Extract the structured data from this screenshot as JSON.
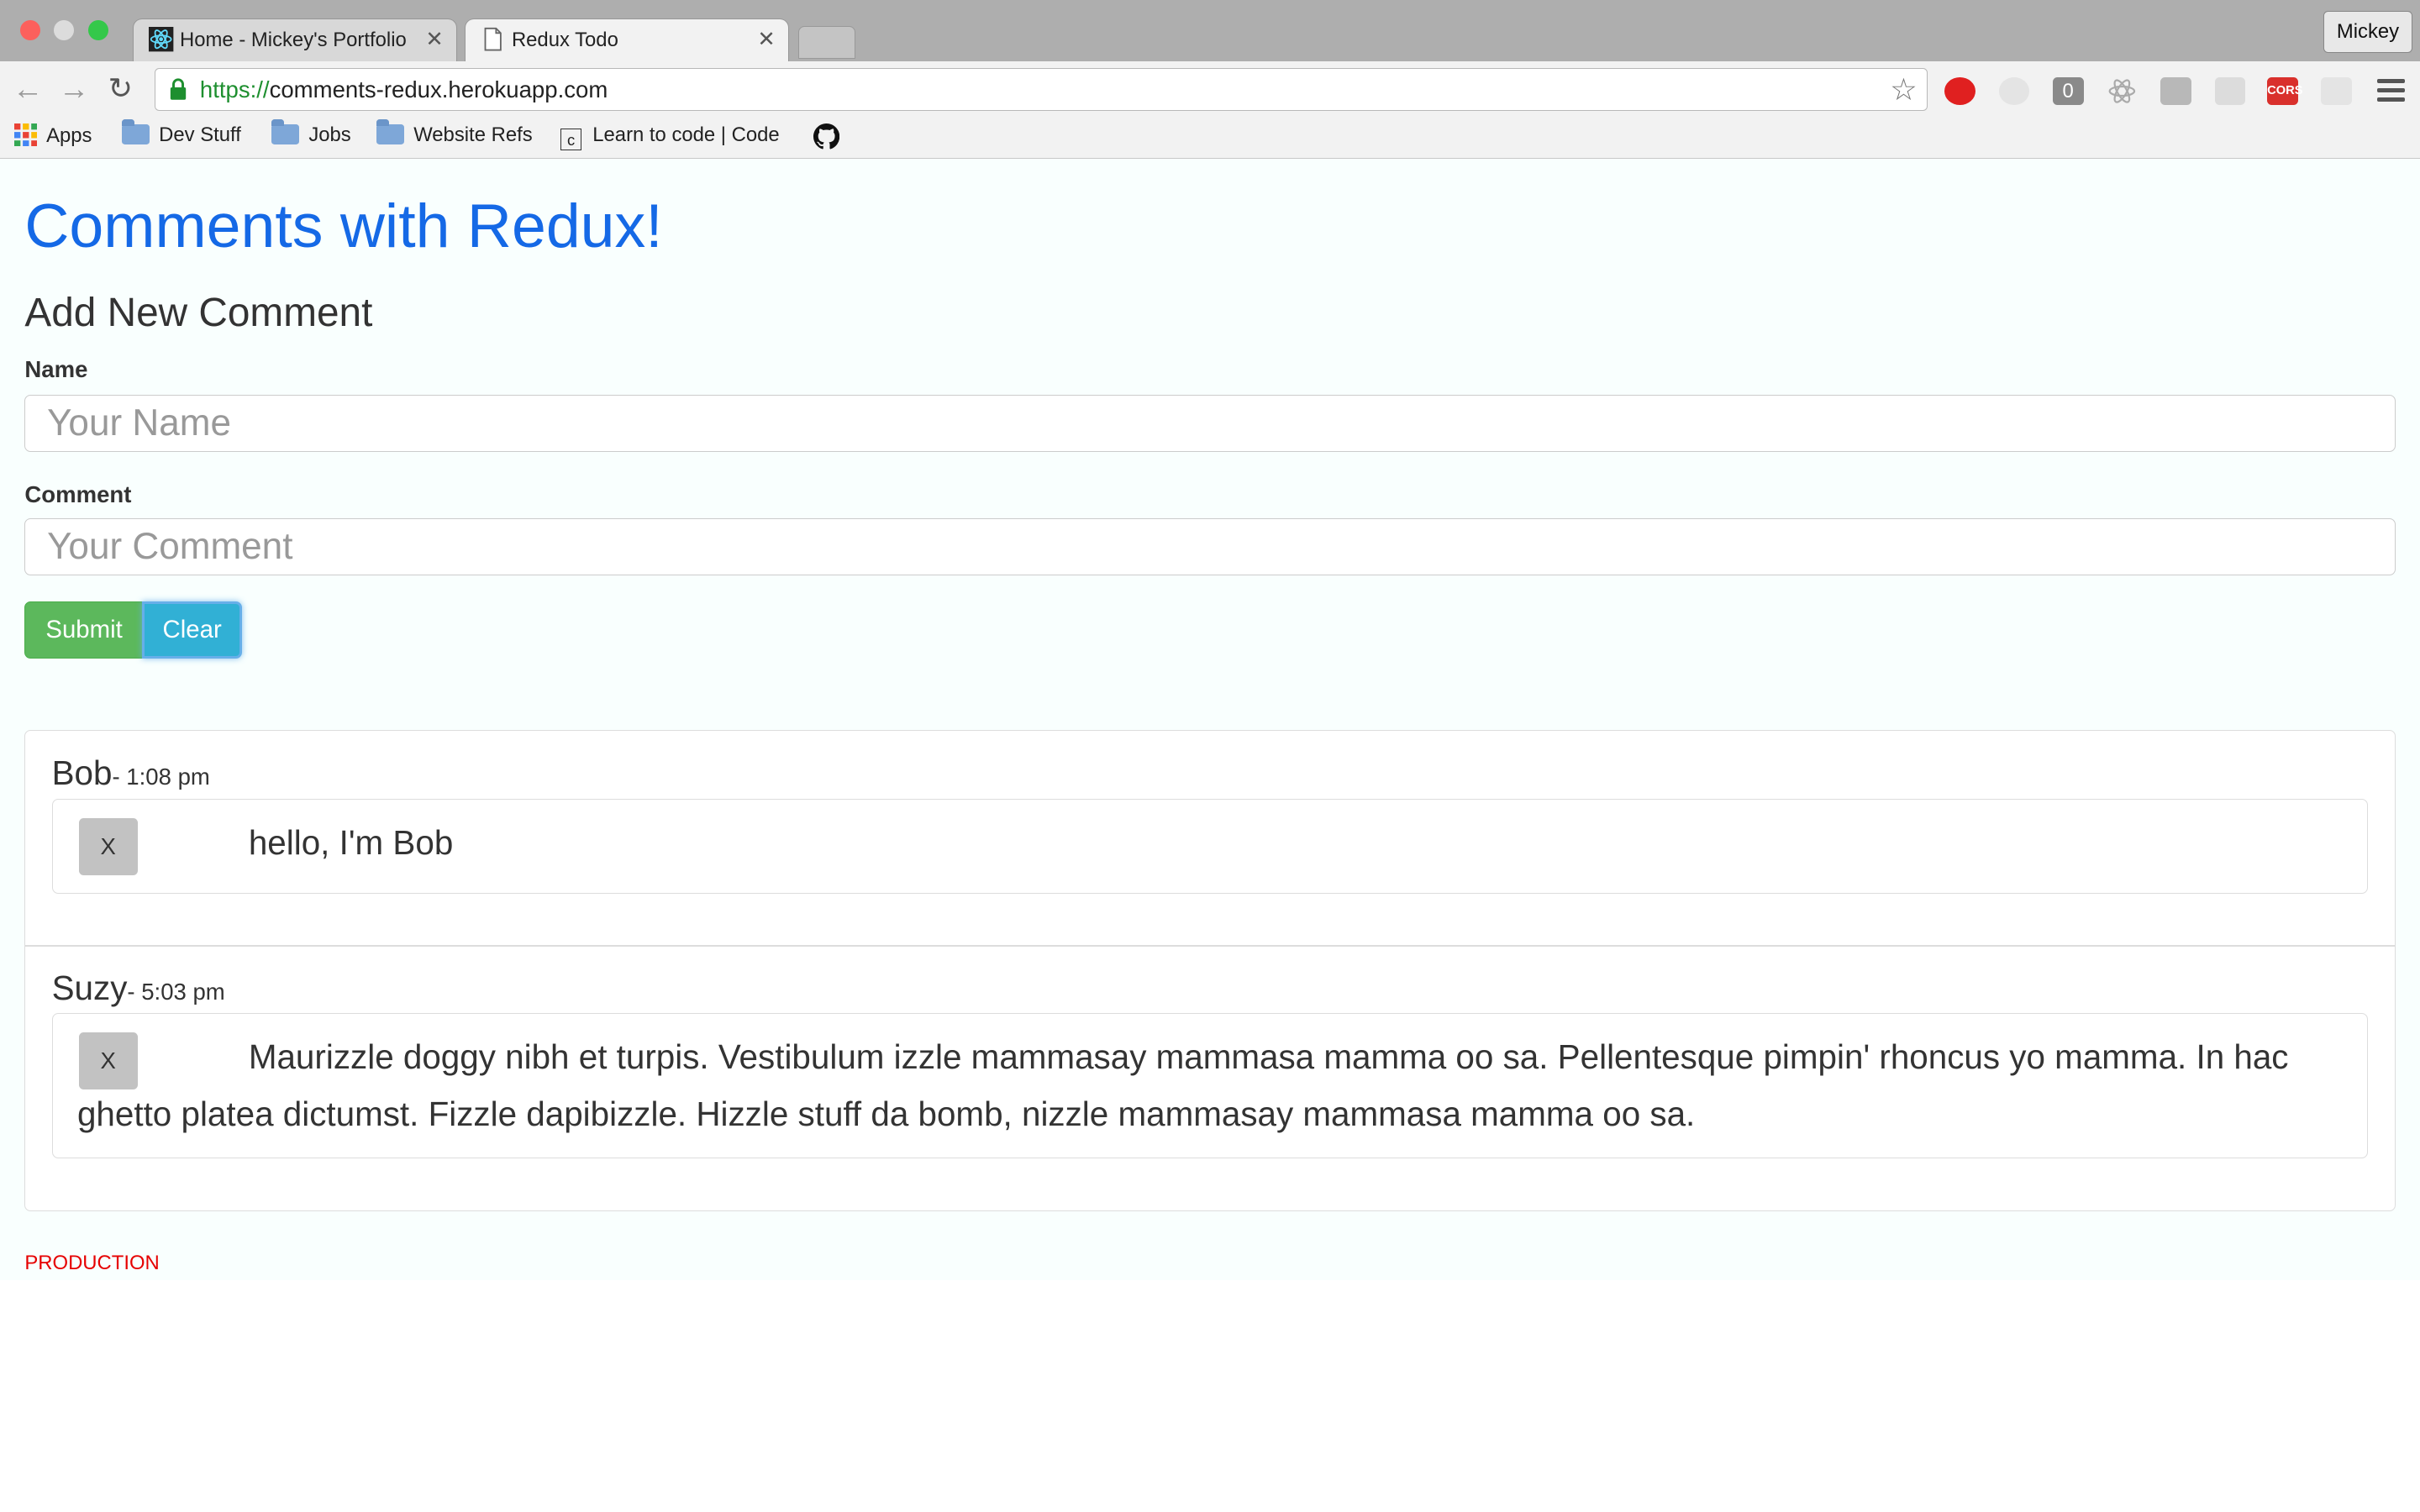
{
  "browser": {
    "tabs": [
      {
        "title": "Home - Mickey's Portfolio",
        "active": false,
        "icon": "react-icon"
      },
      {
        "title": "Redux Todo",
        "active": true,
        "icon": "document-icon"
      }
    ],
    "close_glyph": "✕",
    "profile": "Mickey",
    "url_scheme": "https://",
    "url_host": "comments-redux.herokuapp.com",
    "bookmarks": [
      {
        "label": "Apps",
        "icon": "apps-grid-icon"
      },
      {
        "label": "Dev Stuff",
        "icon": "folder-icon"
      },
      {
        "label": "Jobs",
        "icon": "folder-icon"
      },
      {
        "label": "Website Refs",
        "icon": "folder-icon"
      },
      {
        "label": "Learn to code | Code",
        "icon": "codecademy-icon"
      },
      {
        "label": "",
        "icon": "github-icon"
      }
    ],
    "extensions": [
      "adblock-icon",
      "extension-icon",
      "counter-icon",
      "react-devtools-icon",
      "extension-icon",
      "extension-icon",
      "cors-icon",
      "extension-icon"
    ],
    "cors_label": "CORS",
    "counter_label": "0"
  },
  "page": {
    "title": "Comments with Redux!",
    "form_heading": "Add New Comment",
    "name_label": "Name",
    "name_placeholder": "Your Name",
    "comment_label": "Comment",
    "comment_placeholder": "Your Comment",
    "submit_label": "Submit",
    "clear_label": "Clear"
  },
  "comments": [
    {
      "author": "Bob",
      "time": "- 1:08 pm",
      "text": "hello, I'm Bob",
      "delete_label": "X"
    },
    {
      "author": "Suzy",
      "time": "- 5:03 pm",
      "text": "Maurizzle doggy nibh et turpis. Vestibulum izzle mammasay mammasa mamma oo sa. Pellentesque pimpin' rhoncus yo mamma. In hac ghetto platea dictumst. Fizzle dapibizzle. Hizzle stuff da bomb, nizzle mammasay mammasa mamma oo sa.",
      "delete_label": "X"
    }
  ],
  "environment": "PRODUCTION",
  "colors": {
    "title_blue": "#1569e6",
    "submit_green": "#5cb85c",
    "clear_blue": "#31b0d5",
    "env_red": "#e60000"
  }
}
